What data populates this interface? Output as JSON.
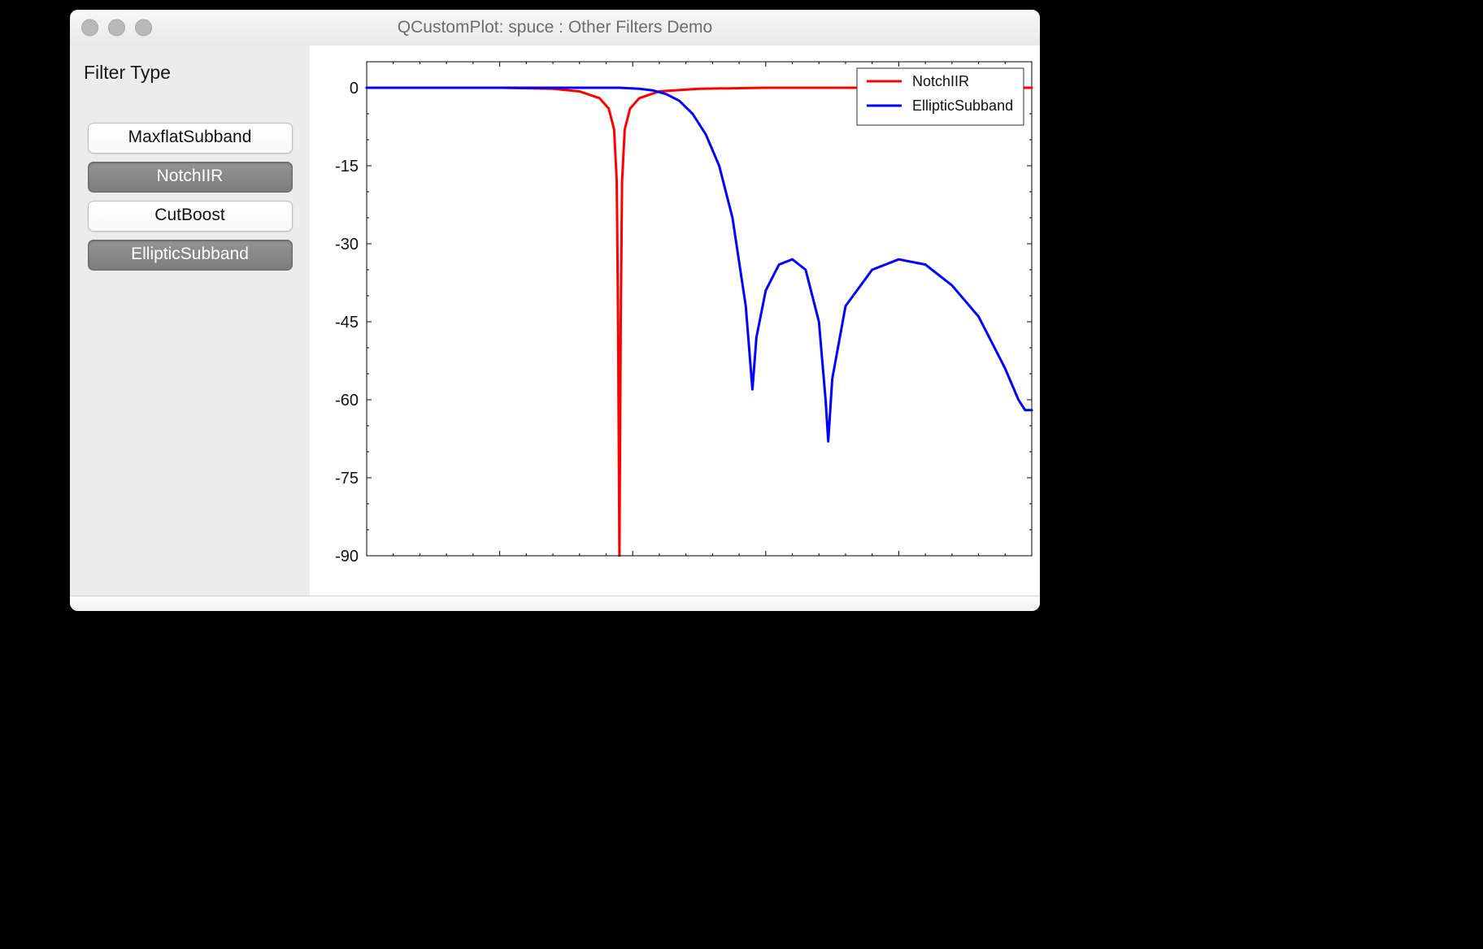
{
  "window": {
    "title": "QCustomPlot: spuce : Other Filters Demo"
  },
  "sidebar": {
    "label": "Filter Type",
    "buttons": [
      {
        "label": "MaxflatSubband",
        "active": false
      },
      {
        "label": "NotchIIR",
        "active": true
      },
      {
        "label": "CutBoost",
        "active": false
      },
      {
        "label": "EllipticSubband",
        "active": true
      }
    ]
  },
  "chart_data": {
    "type": "line",
    "xlabel": "",
    "ylabel": "",
    "xlim": [
      0.0,
      0.5
    ],
    "ylim": [
      -90,
      5
    ],
    "xticks": [
      0.0,
      0.1,
      0.2,
      0.3,
      0.4
    ],
    "yticks": [
      0,
      -15,
      -30,
      -45,
      -60,
      -75,
      -90
    ],
    "legend": {
      "position": "top-right",
      "entries": [
        "NotchIIR",
        "EllipticSubband"
      ]
    },
    "series": [
      {
        "name": "NotchIIR",
        "color": "#ff0000",
        "x": [
          0.0,
          0.05,
          0.1,
          0.14,
          0.16,
          0.175,
          0.182,
          0.186,
          0.188,
          0.189,
          0.19,
          0.191,
          0.192,
          0.194,
          0.198,
          0.205,
          0.22,
          0.25,
          0.3,
          0.4,
          0.5
        ],
        "y": [
          0,
          0,
          0,
          -0.2,
          -0.7,
          -2,
          -4,
          -8,
          -18,
          -45,
          -90,
          -45,
          -18,
          -8,
          -4,
          -2,
          -0.7,
          -0.2,
          0,
          0,
          0
        ]
      },
      {
        "name": "EllipticSubband",
        "color": "#0000ff",
        "x": [
          0.0,
          0.1,
          0.16,
          0.19,
          0.205,
          0.215,
          0.225,
          0.235,
          0.245,
          0.255,
          0.265,
          0.275,
          0.285,
          0.29,
          0.293,
          0.3,
          0.31,
          0.32,
          0.33,
          0.34,
          0.345,
          0.347,
          0.35,
          0.36,
          0.38,
          0.4,
          0.42,
          0.44,
          0.46,
          0.48,
          0.49,
          0.495,
          0.5
        ],
        "y": [
          0,
          0,
          0,
          0,
          -0.2,
          -0.5,
          -1.2,
          -2.5,
          -5,
          -9,
          -15,
          -25,
          -42,
          -58,
          -48,
          -39,
          -34,
          -33,
          -35,
          -45,
          -60,
          -68,
          -56,
          -42,
          -35,
          -33,
          -34,
          -38,
          -44,
          -54,
          -60,
          -62,
          -62
        ]
      }
    ]
  }
}
